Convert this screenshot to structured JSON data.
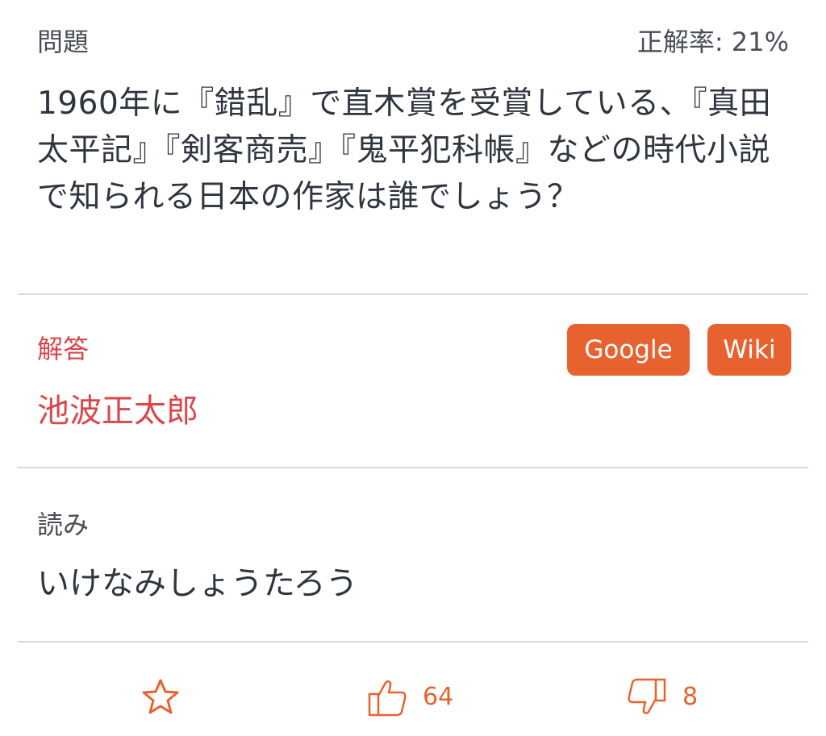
{
  "question": {
    "label": "問題",
    "rate": "正解率: 21%",
    "text": "1960年に『錯乱』で直木賞を受賞している、『真田太平記』『剣客商売』『鬼平犯科帳』などの時代小説で知られる日本の作家は誰でしょう？"
  },
  "answer": {
    "label": "解答",
    "value": "池波正太郎",
    "buttons": {
      "google": "Google",
      "wiki": "Wiki"
    }
  },
  "reading": {
    "label": "読み",
    "value": "いけなみしょうたろう"
  },
  "actions": {
    "likes": "64",
    "dislikes": "8",
    "icons": [
      "star-icon",
      "thumbs-up-icon",
      "thumbs-down-icon"
    ]
  },
  "colors": {
    "accent": "#e8622f",
    "answer_red": "#d8474b",
    "text": "#2f3640",
    "divider": "#d8d8d8"
  }
}
